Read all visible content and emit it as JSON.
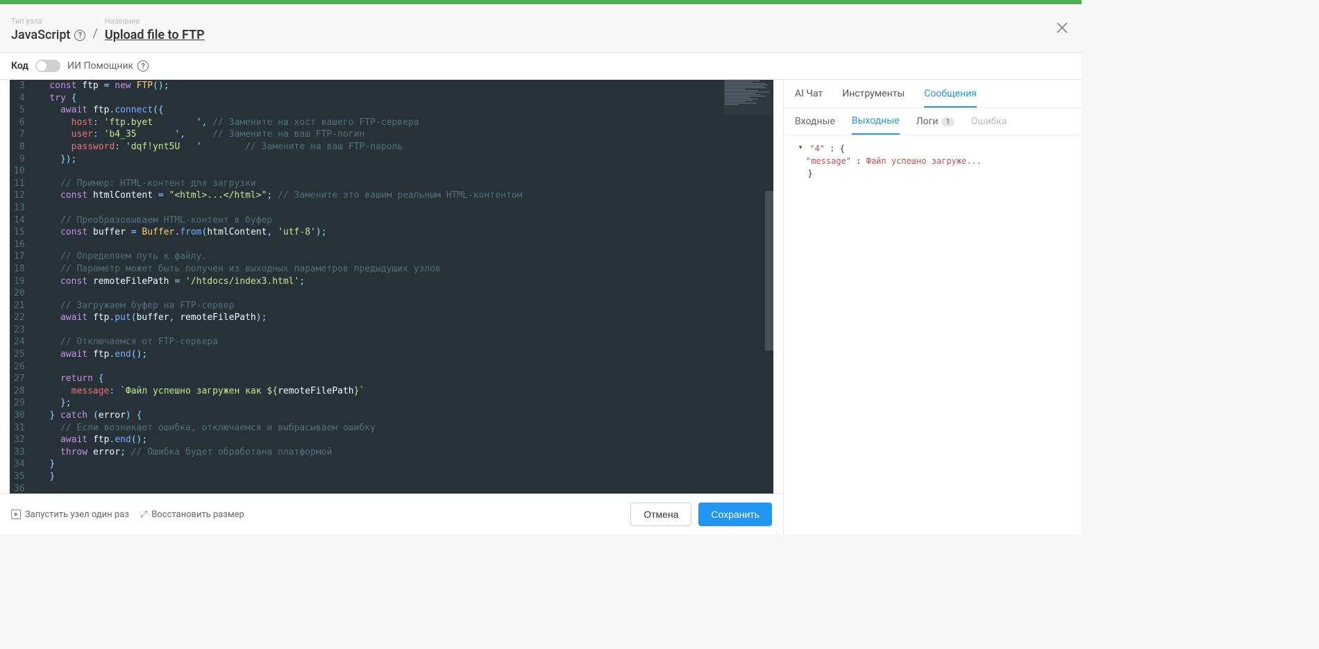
{
  "header": {
    "node_type_label": "Тип узла",
    "node_type_value": "JavaScript",
    "name_label": "Название",
    "name_value": "Upload file to FTP"
  },
  "toolbar": {
    "code_label": "Код",
    "ai_helper_label": "ИИ Помощник"
  },
  "code_lines": [
    {
      "n": 3,
      "html": "<span class='kw'>const</span> <span class='ident'>ftp</span> <span class='punc'>=</span> <span class='kw'>new</span> <span class='cls'>FTP</span><span class='punc'>();</span>"
    },
    {
      "n": 4,
      "html": "<span class='kw'>try</span> <span class='punc'>{</span>"
    },
    {
      "n": 5,
      "html": "  <span class='kw'>await</span> <span class='ident'>ftp</span><span class='punc'>.</span><span class='fn'>connect</span><span class='punc'>({</span>"
    },
    {
      "n": 6,
      "html": "    <span class='prop'>host</span><span class='punc'>:</span> <span class='str'>'ftp.byet        '</span><span class='punc'>,</span> <span class='cmt'>// Замените на хост вашего FTP-сервера</span>"
    },
    {
      "n": 7,
      "html": "    <span class='prop'>user</span><span class='punc'>:</span> <span class='str'>'b4_35       '</span><span class='punc'>,</span>     <span class='cmt'>// Замените на ваш FTP-логин</span>"
    },
    {
      "n": 8,
      "html": "    <span class='prop'>password</span><span class='punc'>:</span> <span class='str'>'dqf!ynt5U   '</span>        <span class='cmt'>// Замените на ваш FTP-пароль</span>"
    },
    {
      "n": 9,
      "html": "  <span class='punc'>});</span>"
    },
    {
      "n": 10,
      "html": ""
    },
    {
      "n": 11,
      "html": "  <span class='cmt'>// Пример: HTML-контент для загрузки</span>"
    },
    {
      "n": 12,
      "html": "  <span class='kw'>const</span> <span class='ident'>htmlContent</span> <span class='punc'>=</span> <span class='str'>\"&lt;html&gt;...&lt;/html&gt;\"</span><span class='punc'>;</span> <span class='cmt'>// Замените это вашим реальным HTML-контентом</span>"
    },
    {
      "n": 13,
      "html": ""
    },
    {
      "n": 14,
      "html": "  <span class='cmt'>// Преобразовываем HTML-контент в буфер</span>"
    },
    {
      "n": 15,
      "html": "  <span class='kw'>const</span> <span class='ident'>buffer</span> <span class='punc'>=</span> <span class='cls'>Buffer</span><span class='punc'>.</span><span class='fn'>from</span><span class='punc'>(</span><span class='ident'>htmlContent</span><span class='punc'>,</span> <span class='str'>'utf-8'</span><span class='punc'>);</span>"
    },
    {
      "n": 16,
      "html": ""
    },
    {
      "n": 17,
      "html": "  <span class='cmt'>// Определяем путь к файлу.</span>"
    },
    {
      "n": 18,
      "html": "  <span class='cmt'>// Параметр может быть получен из выходных параметров предыдущих узлов</span>"
    },
    {
      "n": 19,
      "html": "  <span class='kw'>const</span> <span class='ident'>remoteFilePath</span> <span class='punc'>=</span> <span class='str'>'/htdocs/index3.html'</span><span class='punc'>;</span>"
    },
    {
      "n": 20,
      "html": ""
    },
    {
      "n": 21,
      "html": "  <span class='cmt'>// Загружаем буфер на FTP-сервер</span>"
    },
    {
      "n": 22,
      "html": "  <span class='kw'>await</span> <span class='ident'>ftp</span><span class='punc'>.</span><span class='fn'>put</span><span class='punc'>(</span><span class='ident'>buffer</span><span class='punc'>,</span> <span class='ident'>remoteFilePath</span><span class='punc'>);</span>"
    },
    {
      "n": 23,
      "html": ""
    },
    {
      "n": 24,
      "html": "  <span class='cmt'>// Отключаемся от FTP-сервера</span>"
    },
    {
      "n": 25,
      "html": "  <span class='kw'>await</span> <span class='ident'>ftp</span><span class='punc'>.</span><span class='fn'>end</span><span class='punc'>();</span>"
    },
    {
      "n": 26,
      "html": ""
    },
    {
      "n": 27,
      "html": "  <span class='kw'>return</span> <span class='punc'>{</span>"
    },
    {
      "n": 28,
      "html": "    <span class='prop'>message</span><span class='punc'>:</span> <span class='str'>`Файл успешно загружен как ${</span><span class='ident'>remoteFilePath</span><span class='str'>}`</span>"
    },
    {
      "n": 29,
      "html": "  <span class='punc'>};</span>"
    },
    {
      "n": 30,
      "html": "<span class='punc'>}</span> <span class='kw'>catch</span> <span class='punc'>(</span><span class='ident'>error</span><span class='punc'>)</span> <span class='punc'>{</span>"
    },
    {
      "n": 31,
      "html": "  <span class='cmt'>// Если возникает ошибка, отключаемся и выбрасываем ошибку</span>"
    },
    {
      "n": 32,
      "html": "  <span class='kw'>await</span> <span class='ident'>ftp</span><span class='punc'>.</span><span class='fn'>end</span><span class='punc'>();</span>"
    },
    {
      "n": 33,
      "html": "  <span class='kw'>throw</span> <span class='ident'>error</span><span class='punc'>;</span> <span class='cmt'>// Ошибка будет обработана платформой</span>"
    },
    {
      "n": 34,
      "html": "<span class='punc'>}</span>"
    },
    {
      "n": 35,
      "html": "<span class='punc'>}</span>"
    },
    {
      "n": 36,
      "html": ""
    }
  ],
  "footer": {
    "run_once": "Запустить узел один раз",
    "reset_size": "Восстановить размер",
    "cancel": "Отмена",
    "save": "Сохранить"
  },
  "right_pane": {
    "tabs": {
      "ai_chat": "AI Чат",
      "instruments": "Инструменты",
      "messages": "Сообщения"
    },
    "subtabs": {
      "incoming": "Входные",
      "outgoing": "Выходные",
      "logs": "Логи",
      "logs_count": "1",
      "error": "Ошибка"
    },
    "json": {
      "key": "\"4\"",
      "open": "{",
      "msg_key": "\"message\"",
      "msg_val": "Файл успешно загруже...",
      "close": "}"
    }
  }
}
